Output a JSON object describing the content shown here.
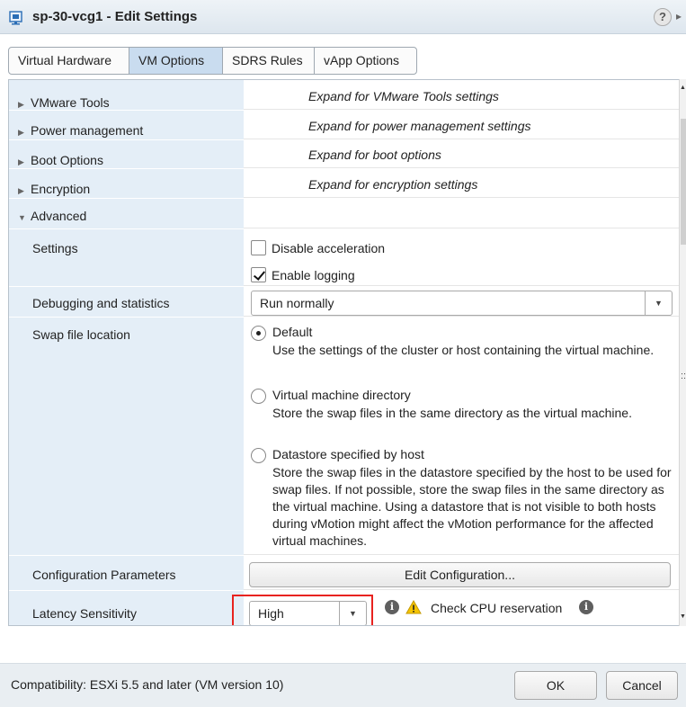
{
  "window": {
    "title": "sp-30-vcg1 - Edit Settings",
    "help_label": "?",
    "more_label": "▸"
  },
  "tabs": [
    {
      "label": "Virtual Hardware",
      "active": false
    },
    {
      "label": "VM Options",
      "active": true
    },
    {
      "label": "SDRS Rules",
      "active": false
    },
    {
      "label": "vApp Options",
      "active": false
    }
  ],
  "sections": {
    "vmware_tools": {
      "label": "VMware Tools",
      "hint": "Expand for VMware Tools settings"
    },
    "power": {
      "label": "Power management",
      "hint": "Expand for power management settings"
    },
    "boot": {
      "label": "Boot Options",
      "hint": "Expand for boot options"
    },
    "encryption": {
      "label": "Encryption",
      "hint": "Expand for encryption settings"
    },
    "advanced": {
      "label": "Advanced"
    }
  },
  "advanced": {
    "settings": {
      "label": "Settings",
      "disable_acceleration": {
        "label": "Disable acceleration",
        "checked": false
      },
      "enable_logging": {
        "label": "Enable logging",
        "checked": true
      }
    },
    "debugging": {
      "label": "Debugging and statistics",
      "value": "Run normally"
    },
    "swap": {
      "label": "Swap file location",
      "options": [
        {
          "title": "Default",
          "desc": "Use the settings of the cluster or host containing the virtual machine.",
          "selected": true
        },
        {
          "title": "Virtual machine directory",
          "desc": "Store the swap files in the same directory as the virtual machine.",
          "selected": false
        },
        {
          "title": "Datastore specified by host",
          "desc": "Store the swap files in the datastore specified by the host to be used for swap files. If not possible, store the swap files in the same directory as the virtual machine. Using a datastore that is not visible to both hosts during vMotion might affect the vMotion performance for the affected virtual machines.",
          "selected": false
        }
      ]
    },
    "config_params": {
      "label": "Configuration Parameters",
      "button": "Edit Configuration..."
    },
    "latency": {
      "label": "Latency Sensitivity",
      "value": "High",
      "warning": "Check CPU reservation"
    }
  },
  "footer": {
    "compatibility": "Compatibility: ESXi 5.5 and later (VM version 10)",
    "ok": "OK",
    "cancel": "Cancel"
  },
  "colors": {
    "label_column": "#e4eef7",
    "active_tab": "#c9dcef",
    "highlight": "#e8231f",
    "warning": "#f5c400"
  },
  "icons": {
    "window": "vm-icon",
    "expand": "triangle-right-icon",
    "collapse": "triangle-down-icon",
    "dropdown": "chevron-down-icon",
    "info": "info-icon",
    "warning": "warning-icon"
  }
}
